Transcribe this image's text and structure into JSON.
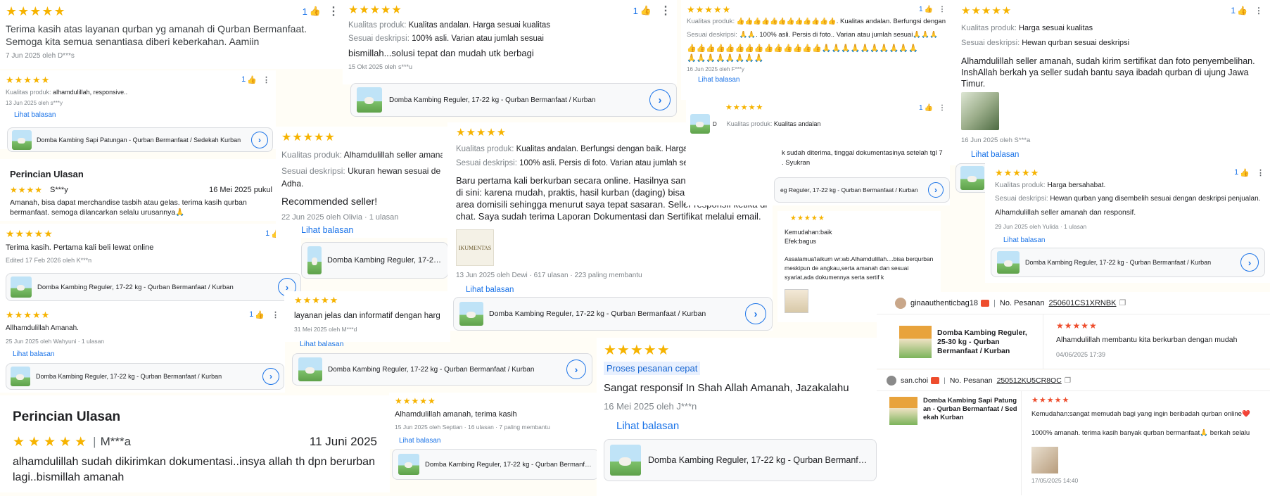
{
  "icons": {
    "like": "thumbs-up-icon",
    "menu": "more-vert-icon",
    "arrow": "chevron-right-icon",
    "chat": "chat-icon",
    "copy": "copy-icon"
  },
  "colors": {
    "star": "#f6b300",
    "link": "#1a73e8",
    "chat": "#ee4d2d"
  },
  "common": {
    "stars": "★★★★★",
    "like_count": "1",
    "reply_link": "Lihat balasan",
    "detail_title": "Perincian Ulasan",
    "label_quality": "Kualitas produk:",
    "label_desc": "Sesuai deskripsi:",
    "label_ease": "Kemudahan:",
    "prod_reguler": "Domba Kambing Reguler, 17-22 kg - Qurban Bermanfaat / Kurban",
    "prod_reguler_cut": "Domba Kambing Reguler, 17-22 kg - Qurban Bermanfaat / Kurb",
    "prod_patungan": "Domba Kambing Sapi Patungan - Qurban Bermanfaat / Sedekah Kurban"
  },
  "r1": {
    "text": "Terima kasih atas layanan qurban yg amanah di Qurban Bermanfaat. Semoga kita semua senantiasa diberi keberkahan. Aamiin",
    "meta": "7 Jun 2025 oleh D***s"
  },
  "r2": {
    "quality": "alhamdulillah, responsive..",
    "meta": "13 Jun 2025 oleh s***y"
  },
  "r3": {
    "stars": "★★★★",
    "user": "S***y",
    "date": "16 Mei 2025 pukul",
    "text": "Amanah, bisa dapat merchandise tasbih atau gelas. terima kasih qurban bermanfaat. semoga dilancarkan selalu urusannya🙏"
  },
  "r4": {
    "text": "Terima kasih. Pertama kali beli lewat online",
    "meta": "Edited 17 Feb 2026 oleh K***n"
  },
  "r5": {
    "text": "Allhamdulillah Amanah.",
    "meta": "25 Jun 2025 oleh Wahyuni · 1 ulasan"
  },
  "r6": {
    "stars": "★★★★★",
    "user": "M***a",
    "date": "11 Juni 2025",
    "text": "alhamdulillah sudah dikirimkan dokumentasi..insya allah th dpn berurban lagi..bismillah amanah"
  },
  "r7": {
    "quality": "Kualitas andalan. Harga sesuai kualitas",
    "desc": "100% asli. Varian atau jumlah sesuai",
    "text": "bismillah...solusi tepat dan mudah utk berbagi",
    "meta": "15 Okt 2025 oleh s***u"
  },
  "r8": {
    "quality": "Alhamdulillah seller amanah",
    "desc": "Ukuran hewan sesuai de",
    "text_a": "Adha.",
    "text_b": "Recommended seller!",
    "meta": "22 Jun 2025 oleh Olivia · 1 ulasan"
  },
  "r9": {
    "text": "layanan jelas dan informatif dengan harg",
    "meta": "31 Mei 2025 oleh M***d"
  },
  "r10": {
    "quality": "Kualitas andalan. Berfungsi dengan baik. Harga sesuai kualitas",
    "desc": "100% asli. Persis di foto. Varian atau jumlah sesuai",
    "text": "Baru pertama kali berkurban secara online. Hasilnya sangat puas mencoba di sini: karena mudah, praktis, hasil kurban (daging) bisa distribusi di luar area domisili sehingga menurut saya tepat sasaran. Seller responsif ketika di chat. Saya sudah terima Laporan Dokumentasi dan Sertifikat melalui email.",
    "img_text": "IKUMENTAS",
    "meta": "13 Jun 2025 oleh Dewi · 617 ulasan · 223 paling membantu"
  },
  "r11": {
    "text": "Alhamdulillah amanah, terima kasih",
    "meta": "15 Jun 2025 oleh Septian · 16 ulasan · 7 paling membantu"
  },
  "r12": {
    "badge": "Proses pesanan cepat",
    "text": "Sangat responsif In Shah Allah Amanah, Jazakalahu",
    "meta": "16 Mei 2025 oleh J***n"
  },
  "r13": {
    "quality": "👍👍👍👍👍👍👍👍👍👍👍👍. Kualitas andalan. Berfungsi dengan baik. Ha",
    "desc": "🙏🙏. 100% asli. Persis di foto.. Varian atau jumlah sesuai🙏🙏🙏",
    "emoji_a": "👍👍👍👍👍👍👍👍👍👍👍👍👍👍🙏🙏🙏🙏🙏🙏🙏🙏🙏🙏",
    "emoji_b": "🙏🙏🙏🙏🙏🙏🙏🙏",
    "meta": "16 Jun 2025 oleh F***y"
  },
  "r14": {
    "quality": "Kualitas andalan",
    "frag_a": "k sudah diterima, tinggal dokumentasinya setelah tgl 7",
    "frag_b": ". Syukran",
    "prod_a": "D",
    "prod_b": "eg Reguler, 17-22 kg - Qurban Bermanfaat / Kurban"
  },
  "r15": {
    "stars": "★★★★★",
    "ease": "baik",
    "efek": "Efek:bagus",
    "text": "Assalamua'laikum wr.wb.Alhamdulillah....bisa berqurban meskipun de angkau,serta amanah dan sesuai syariat,ada dokumennya serta sertif k"
  },
  "r16": {
    "quality": "Harga sesuai kualitas",
    "desc": "Hewan qurban sesuai deskripsi",
    "text": "Alhamdulillah seller amanah, sudah kirim sertifikat dan foto penyembelihan. InshAllah berkah ya seller sudah bantu saya ibadah qurban di ujung Jawa Timur.",
    "meta": "16 Jun 2025 oleh S***a"
  },
  "r17": {
    "quality": "Harga bersahabat.",
    "desc": "Hewan qurban yang disembelih sesuai dengan deskripsi penjualan.",
    "text": "Alhamdulillah seller amanah dan responsif.",
    "meta": "29 Jun 2025 oleh Yulida · 1 ulasan"
  },
  "o1": {
    "user": "ginaauthenticbag18",
    "order_label": "No. Pesanan",
    "order_no": "250601CS1XRNBK",
    "product": "Domba Kambing Reguler, 25-30 kg - Qurban Bermanfaat / Kurban",
    "text": "Alhamdulillah membantu kita berkurban dengan mudah",
    "date": "04/06/2025 17:39"
  },
  "o2": {
    "user": "san.choi",
    "order_label": "No. Pesanan",
    "order_no": "250512KU5CR8OC",
    "product": "Domba Kambing Sapi Patung an - Qurban Bermanfaat / Sed ekah Kurban",
    "ease": "Kemudahan:sangat memudah bagi yang ingin beribadah qurban online❤️",
    "text": "1000% amanah. terima kasih banyak qurban bermanfaat🙏 berkah selalu",
    "date": "17/05/2025 14:40"
  }
}
